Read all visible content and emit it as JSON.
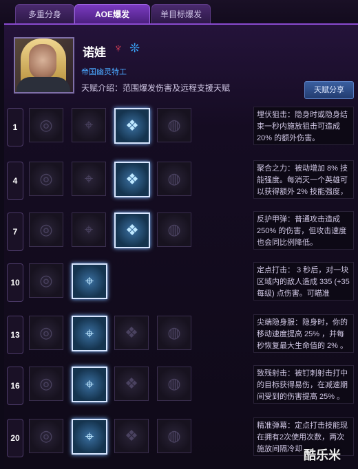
{
  "tabs": [
    {
      "label": "多重分身"
    },
    {
      "label": "AOE爆发"
    },
    {
      "label": "单目标爆发"
    }
  ],
  "hero": {
    "name": "诺娃",
    "role": "帝国幽灵特工",
    "description": "天赋介绍：范围爆发伤害及远程支援天赋",
    "share_label": "天赋分享",
    "icons": [
      "role-icon",
      "terran-icon"
    ]
  },
  "tiers": [
    {
      "level": "1",
      "active_slot": 2,
      "slots": 4,
      "description": "埋伏狙击：隐身时或隐身结束一秒内施放狙击可造成 20% 的额外伤害。"
    },
    {
      "level": "4",
      "active_slot": 2,
      "slots": 4,
      "description": "聚合之力：被动增加 8% 技能强度。每消灭一个英雄可以获得额外 2% 技能强度，"
    },
    {
      "level": "7",
      "active_slot": 2,
      "slots": 4,
      "description": "反护甲弹：普通攻击造成 250% 的伤害，但攻击速度也会同比例降低。"
    },
    {
      "level": "10",
      "active_slot": 1,
      "slots": 2,
      "description": "定点打击： 3 秒后，对一块区域内的敌人造成 335 (+35 每级) 点伤害。可瞄准"
    },
    {
      "level": "13",
      "active_slot": 1,
      "slots": 4,
      "description": "尖端隐身服：隐身时，你的移动速度提高 25% ，并每秒恢复最大生命值的 2% 。"
    },
    {
      "level": "16",
      "active_slot": 1,
      "slots": 4,
      "description": "致残射击：被钉刺射击打中的目标获得易伤，在减速期间受到的伤害提高 25% 。"
    },
    {
      "level": "20",
      "active_slot": 1,
      "slots": 4,
      "description": "精准弹幕：定点打击技能现在拥有2次使用次数，两次施放间隔冷却"
    }
  ],
  "watermark": "酷乐米"
}
